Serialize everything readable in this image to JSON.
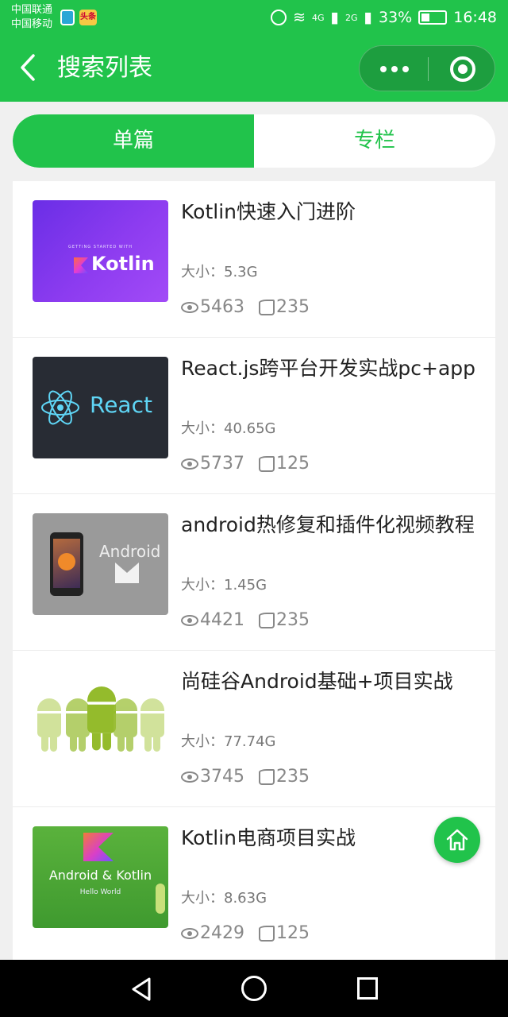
{
  "status_bar": {
    "carrier_1": "中国联通",
    "carrier_2": "中国移动",
    "app_badge": "头条",
    "signal_1": "4G",
    "signal_2": "2G",
    "battery": "33%",
    "time": "16:48"
  },
  "header": {
    "title": "搜索列表"
  },
  "tabs": [
    {
      "label": "单篇",
      "active": true
    },
    {
      "label": "专栏",
      "active": false
    }
  ],
  "items": [
    {
      "title": "Kotlin快速入门进阶",
      "size": "大小：5.3G",
      "views": "5463",
      "likes": "235",
      "thumb_caption": "GETTING STARTED WITH",
      "thumb_word": "Kotlin"
    },
    {
      "title": "React.js跨平台开发实战pc+app",
      "size": "大小：40.65G",
      "views": "5737",
      "likes": "125",
      "thumb_word": "React"
    },
    {
      "title": "android热修复和插件化视频教程",
      "size": "大小：1.45G",
      "views": "4421",
      "likes": "235",
      "thumb_word": "Android"
    },
    {
      "title": "尚硅谷Android基础+项目实战",
      "size": "大小：77.74G",
      "views": "3745",
      "likes": "235"
    },
    {
      "title": "Kotlin电商项目实战",
      "size": "大小：8.63G",
      "views": "2429",
      "likes": "125",
      "thumb_word": "Android & Kotlin",
      "thumb_caption": "Hello World"
    }
  ],
  "colors": {
    "brand_green": "#21c34b",
    "text_dark": "#222222",
    "text_muted": "#888888"
  },
  "icons": [
    "back-icon",
    "more-icon",
    "close-icon",
    "eye-icon",
    "thumbs-up-icon",
    "home-icon"
  ]
}
